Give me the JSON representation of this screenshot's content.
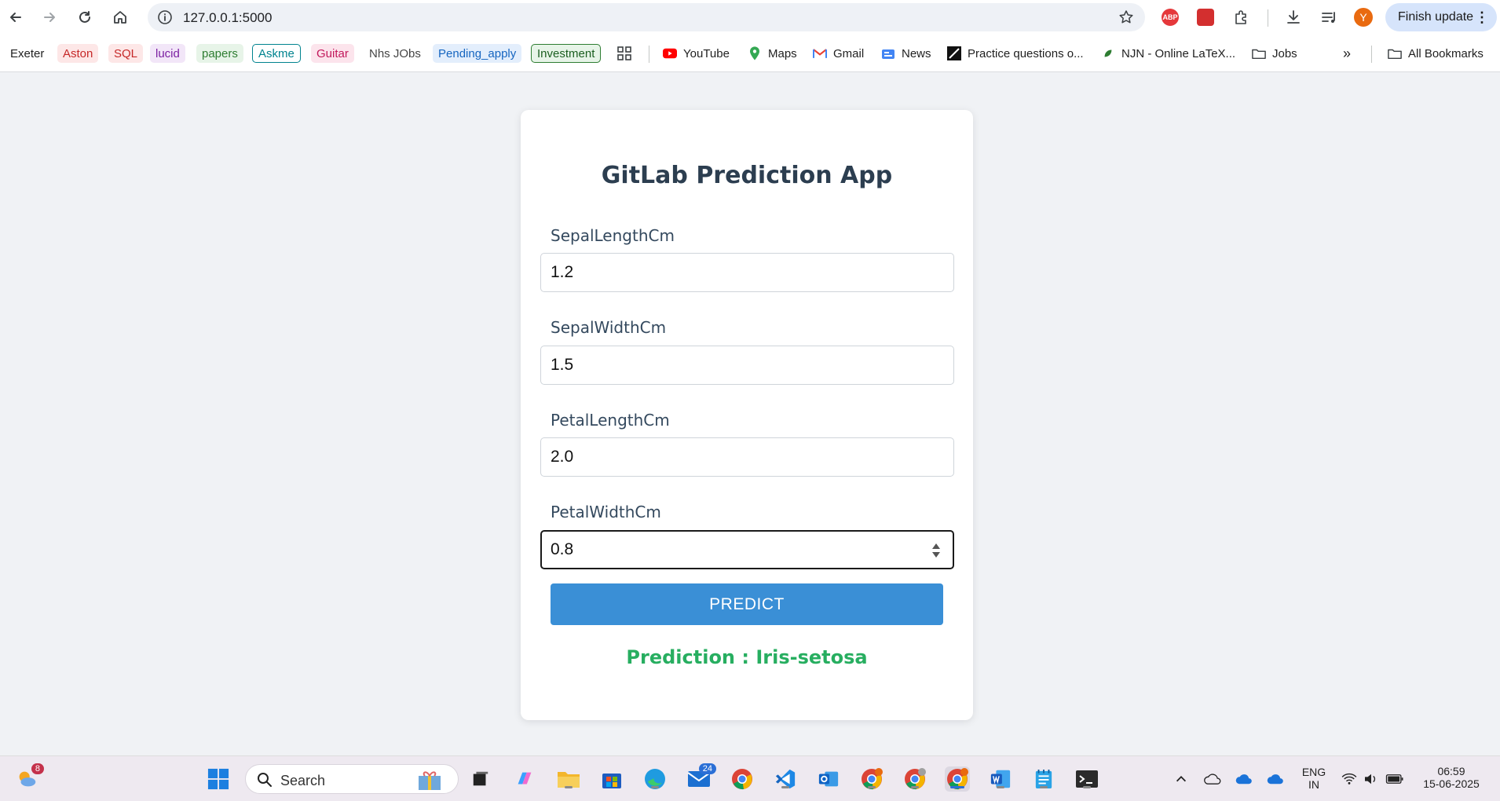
{
  "browser": {
    "url": "127.0.0.1:5000",
    "finish_update_label": "Finish update",
    "profile_initial": "Y",
    "abp_label": "ABP"
  },
  "bookmarks": [
    {
      "label": "Exeter",
      "color": "#444444",
      "bg": ""
    },
    {
      "label": "Aston",
      "color": "#c62828",
      "bg": "#fde7e7"
    },
    {
      "label": "SQL",
      "color": "#c62828",
      "bg": "#fde7e7"
    },
    {
      "label": "lucid",
      "color": "#7b1fa2",
      "bg": "#f2e6f8"
    },
    {
      "label": "papers",
      "color": "#2e7d32",
      "bg": "#e7f4e8"
    },
    {
      "label": "Askme",
      "color": "#00838f",
      "bg": "#ffffff"
    },
    {
      "label": "Guitar",
      "color": "#c2185b",
      "bg": "#fce4ec"
    },
    {
      "label": "Nhs JObs",
      "color": "#444444",
      "bg": ""
    },
    {
      "label": "Pending_apply",
      "color": "#1565c0",
      "bg": "#e3eefc"
    },
    {
      "label": "Investment",
      "color": "#2e7d32",
      "bg": "#e7f4e8"
    }
  ],
  "bookmark_links": {
    "youtube": "YouTube",
    "maps": "Maps",
    "gmail": "Gmail",
    "news": "News",
    "practice": "Practice questions o...",
    "njn": "NJN - Online LaTeX...",
    "jobs": "Jobs",
    "all_bookmarks": "All Bookmarks"
  },
  "app": {
    "title": "GitLab Prediction App",
    "fields": [
      {
        "label": "SepalLengthCm",
        "value": "1.2"
      },
      {
        "label": "SepalWidthCm",
        "value": "1.5"
      },
      {
        "label": "PetalLengthCm",
        "value": "2.0"
      },
      {
        "label": "PetalWidthCm",
        "value": "0.8"
      }
    ],
    "predict_label": "PREDICT",
    "prediction_text": "Prediction : Iris-setosa"
  },
  "taskbar": {
    "search_placeholder": "Search",
    "weather_badge": "8",
    "mail_badge": "24",
    "language": "ENG",
    "region": "IN",
    "time": "06:59",
    "date": "15-06-2025"
  },
  "colors": {
    "accent_button": "#3a8fd6",
    "prediction_green": "#27ae60",
    "title_navy": "#2c3e50"
  }
}
